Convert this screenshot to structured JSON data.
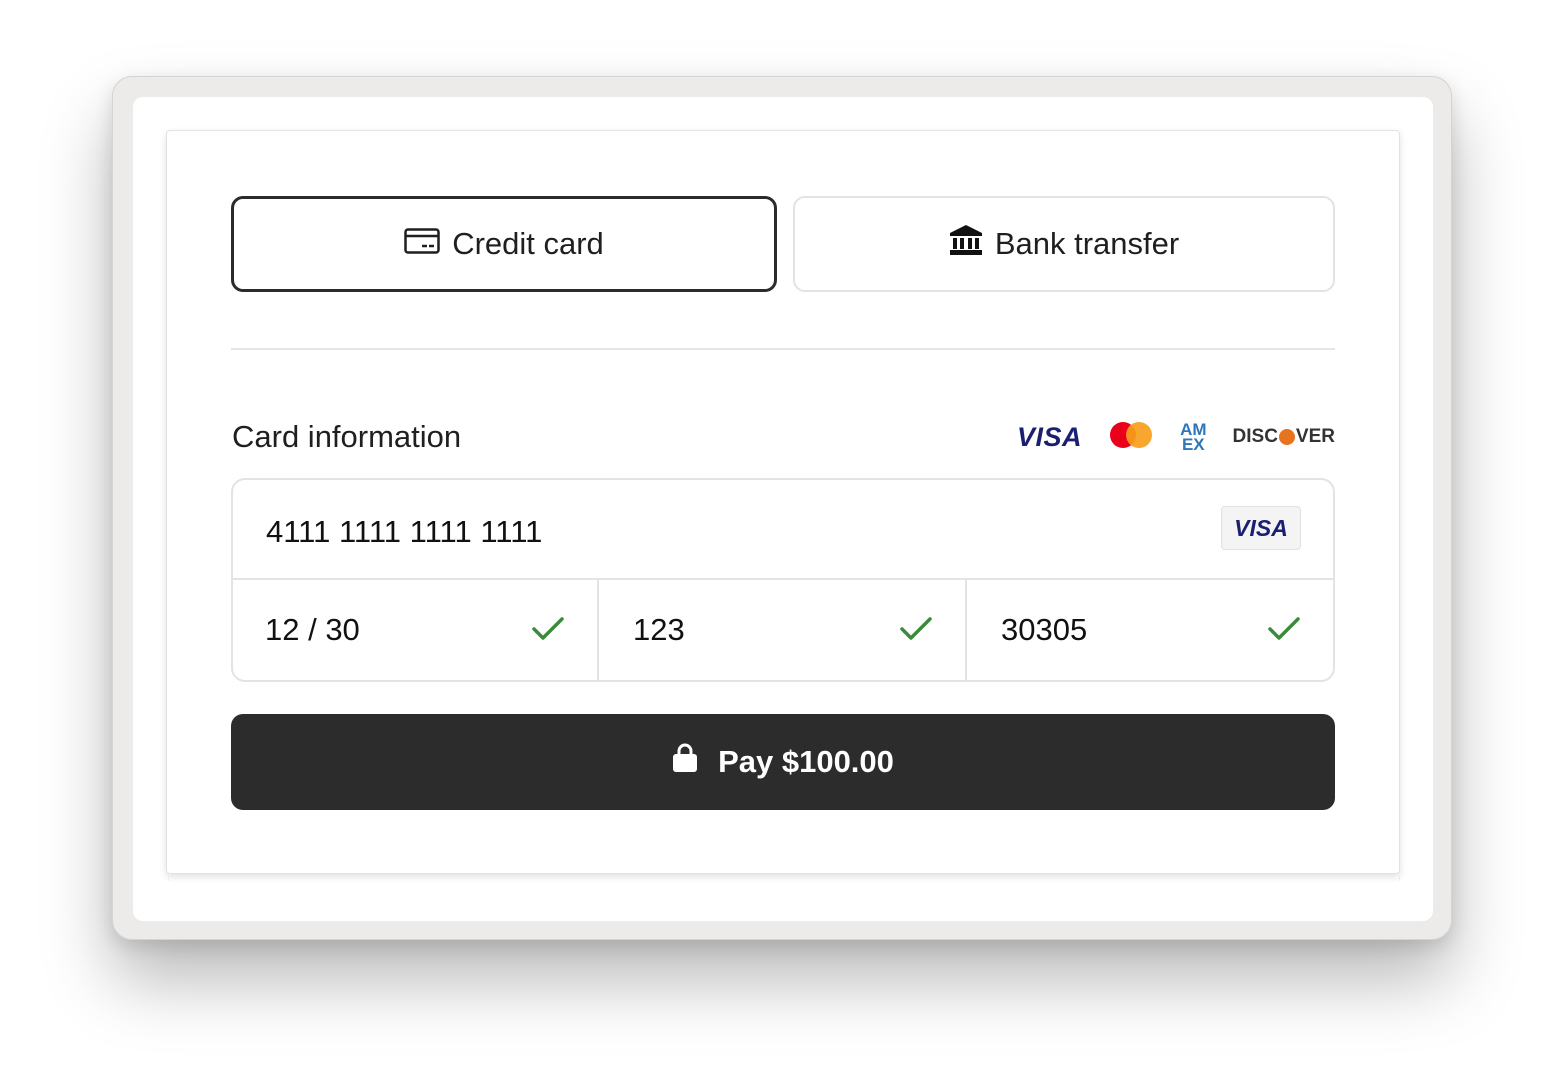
{
  "tabs": {
    "credit_card": {
      "label": "Credit card",
      "icon": "credit-card-icon",
      "active": true
    },
    "bank_transfer": {
      "label": "Bank transfer",
      "icon": "bank-icon",
      "active": false
    }
  },
  "card_section": {
    "label": "Card information",
    "accepted_brands": [
      {
        "name": "VISA",
        "icon": "visa-logo"
      },
      {
        "name": "Mastercard",
        "icon": "mastercard-logo"
      },
      {
        "name": "AMEX",
        "icon": "amex-logo"
      },
      {
        "name": "DISCOVER",
        "icon": "discover-logo"
      }
    ]
  },
  "fields": {
    "card_number": {
      "value": "4111 1111 1111 1111",
      "detected_brand": "VISA"
    },
    "expiry": {
      "value": "12 / 30",
      "valid": true
    },
    "cvc": {
      "value": "123",
      "valid": true
    },
    "zip": {
      "value": "30305",
      "valid": true
    }
  },
  "pay_button": {
    "label": "Pay $100.00",
    "icon": "lock-icon"
  },
  "colors": {
    "accent_dark": "#2c2c2c",
    "valid_check": "#3c8a3c",
    "visa_blue": "#1a1f71",
    "mastercard_red": "#eb001b",
    "mastercard_orange": "#f79e1b",
    "amex_blue": "#2e77bb",
    "discover_orange": "#e8731f"
  }
}
